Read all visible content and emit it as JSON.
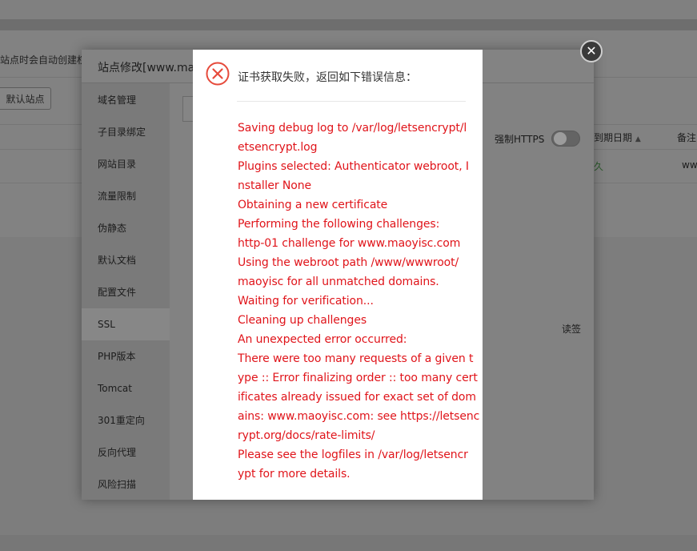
{
  "background": {
    "notice_text": "站点时会自动创建权",
    "default_site_button": "默认站点",
    "expiry_header": "到期日期",
    "remark_header": "备注",
    "row_status": "久",
    "row_remark": "ww",
    "tag_text": "读签"
  },
  "site_layer": {
    "title": "站点修改[www.ma",
    "sidebar": [
      {
        "label": "域名管理"
      },
      {
        "label": "子目录绑定"
      },
      {
        "label": "网站目录"
      },
      {
        "label": "流量限制"
      },
      {
        "label": "伪静态"
      },
      {
        "label": "默认文档"
      },
      {
        "label": "配置文件"
      },
      {
        "label": "SSL"
      },
      {
        "label": "PHP版本"
      },
      {
        "label": "Tomcat"
      },
      {
        "label": "301重定向"
      },
      {
        "label": "反向代理"
      },
      {
        "label": "风险扫描"
      }
    ],
    "active_item": "SSL",
    "force_https_label": "强制HTTPS",
    "force_https_enabled": false,
    "close_icon": "close-icon"
  },
  "dialog": {
    "icon": "error-circle-icon",
    "accent_color": "#e0141a",
    "title": "证书获取失败，返回如下错误信息：",
    "message_lines": [
      "Saving debug log to /var/log/letsencrypt/l",
      "etsencrypt.log",
      "Plugins selected: Authenticator webroot, I",
      "nstaller None",
      "Obtaining a new certificate",
      "Performing the following challenges:",
      "http-01 challenge for www.maoyisc.com",
      "Using the webroot path /www/wwwroot/",
      "maoyisc for all unmatched domains.",
      "Waiting for verification...",
      "Cleaning up challenges",
      "An unexpected error occurred:",
      "There were too many requests of a given t",
      "ype :: Error finalizing order :: too many cert",
      "ificates already issued for exact set of dom",
      "ains: www.maoyisc.com: see https://letsenc",
      "rypt.org/docs/rate-limits/",
      "Please see the logfiles in /var/log/letsencr",
      "ypt for more details."
    ]
  }
}
